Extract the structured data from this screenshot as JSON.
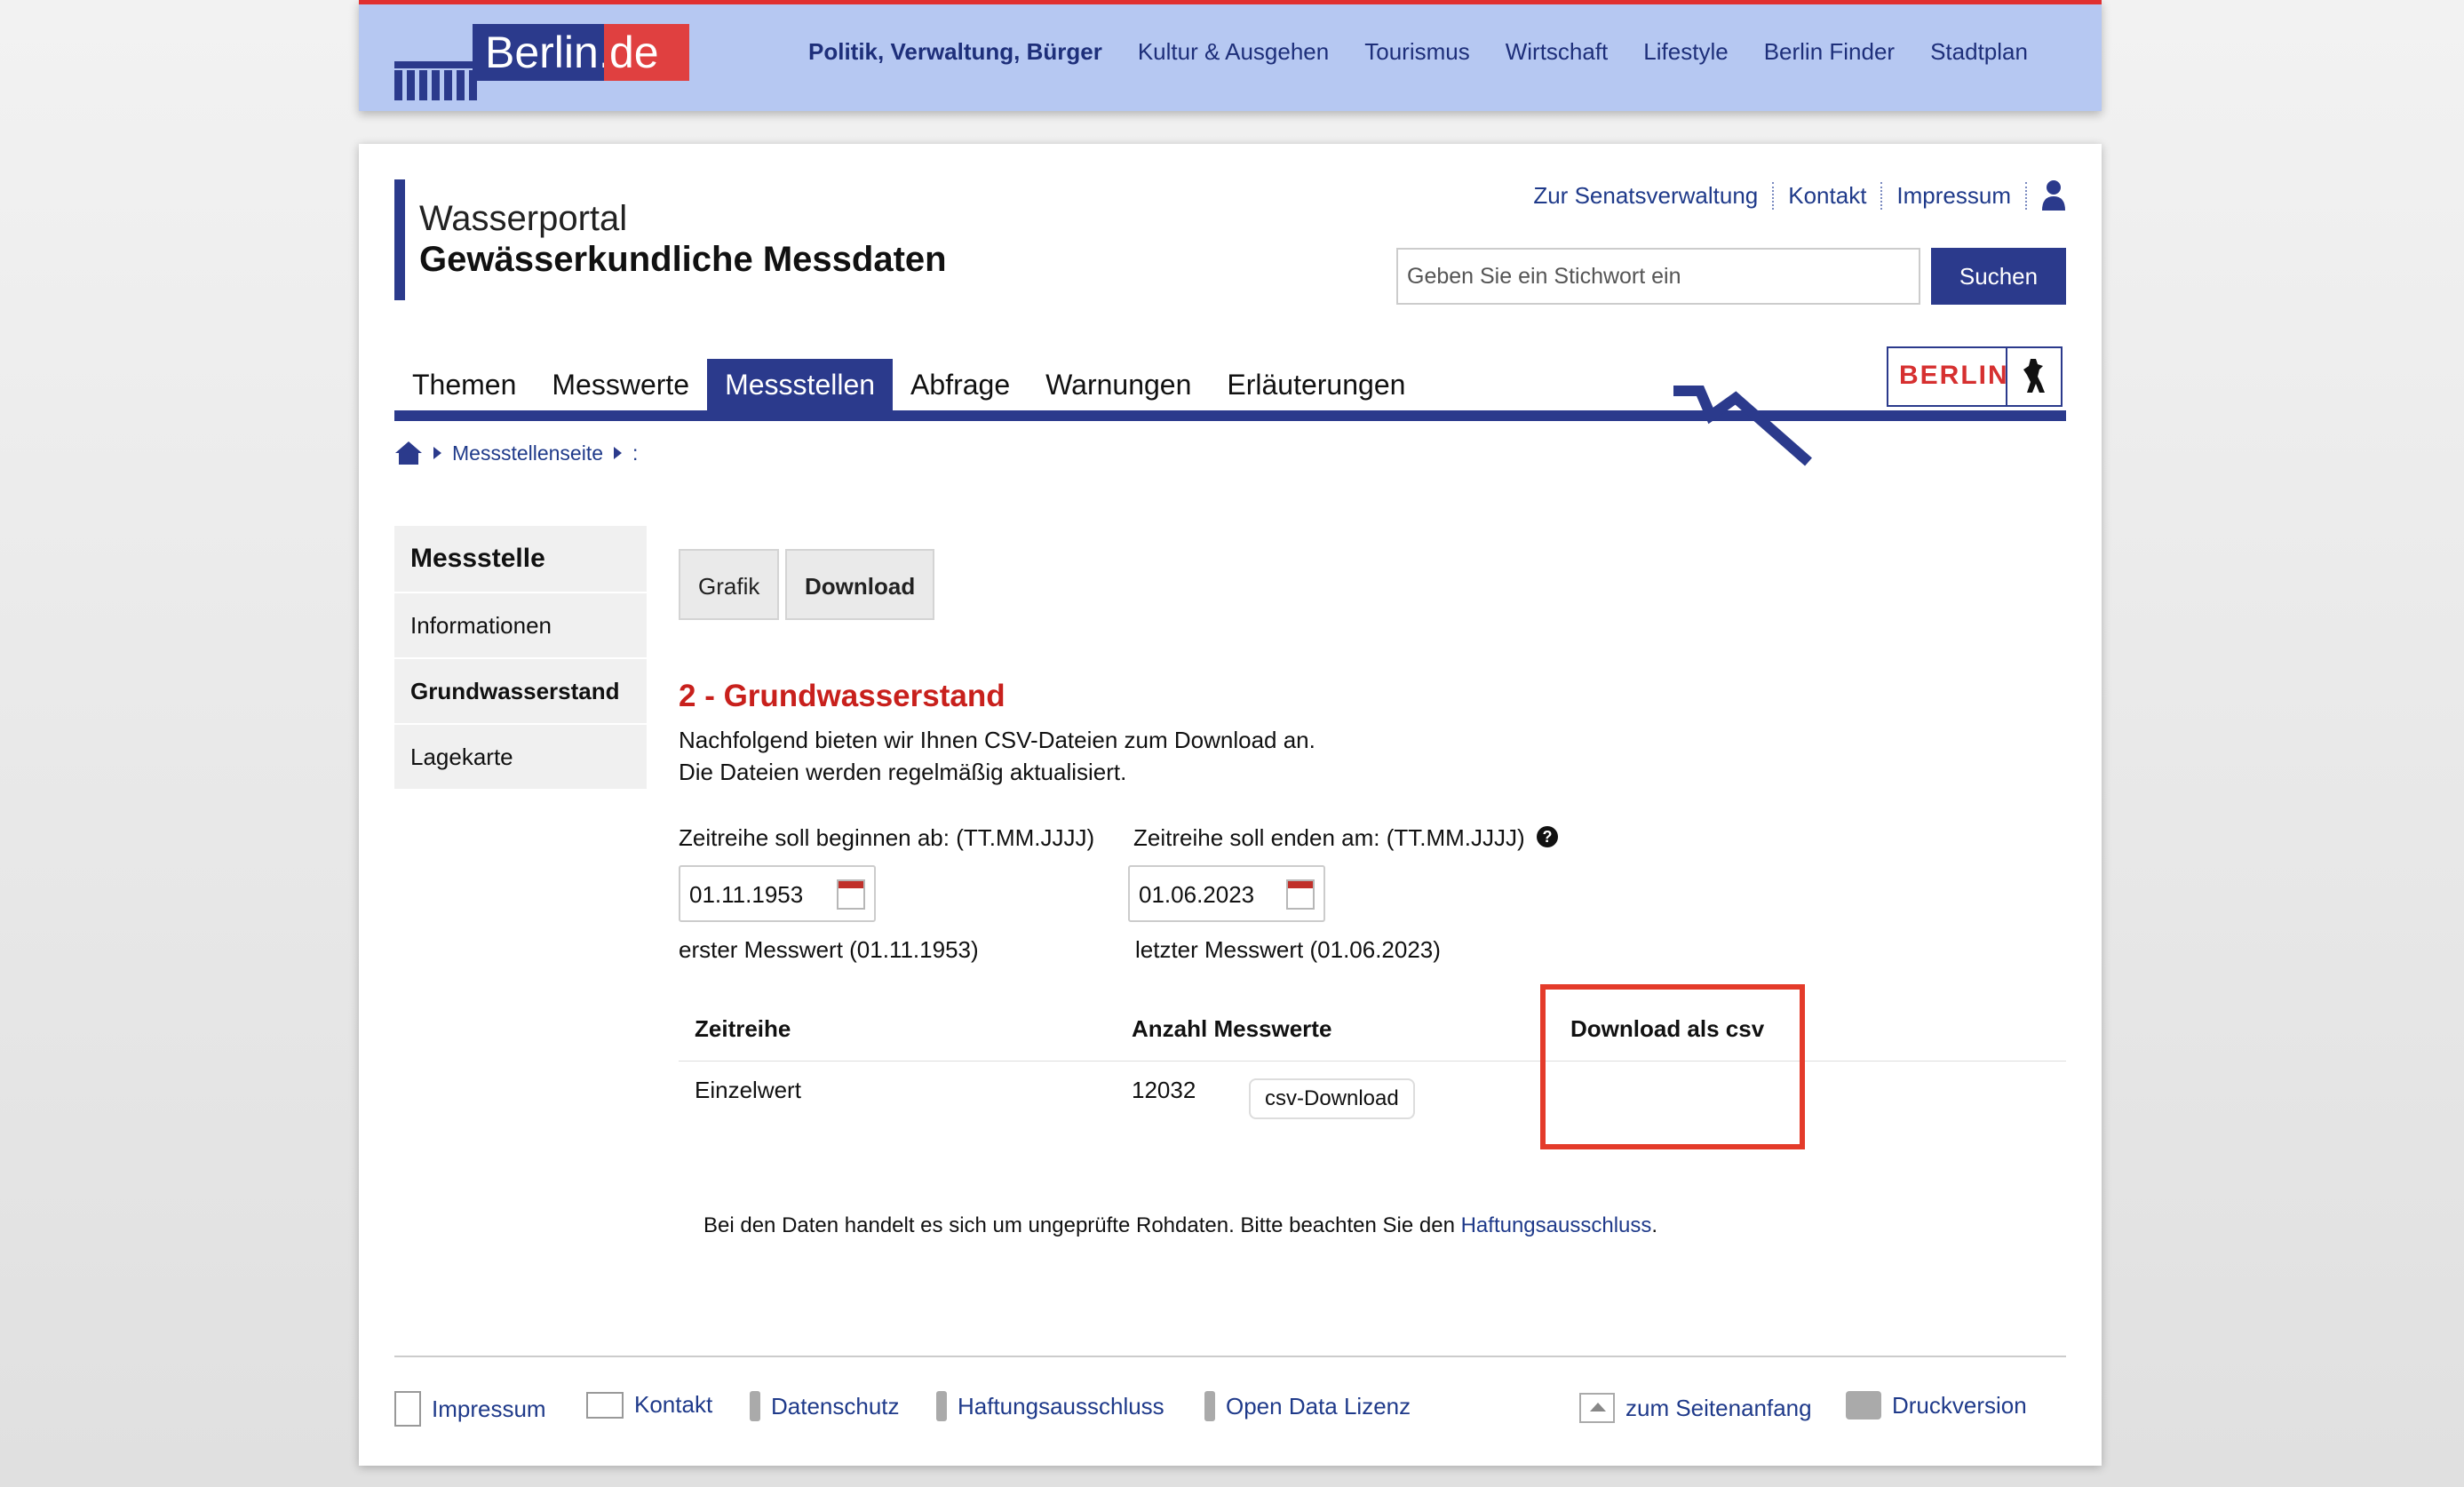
{
  "topbar": {
    "logo_text_main": "Berlin.",
    "logo_text_de": "de",
    "nav": [
      "Politik, Verwaltung, Bürger",
      "Kultur & Ausgehen",
      "Tourismus",
      "Wirtschaft",
      "Lifestyle",
      "Berlin Finder",
      "Stadtplan"
    ]
  },
  "header": {
    "title": "Wasserportal",
    "subtitle": "Gewässerkundliche Messdaten",
    "service_links": [
      "Zur Senatsverwaltung",
      "Kontakt",
      "Impressum"
    ],
    "search_placeholder": "Geben Sie ein Stichwort ein",
    "search_button": "Suchen",
    "berlin_badge": "BERLIN"
  },
  "mainnav": {
    "tabs": [
      "Themen",
      "Messwerte",
      "Messstellen",
      "Abfrage",
      "Warnungen",
      "Erläuterungen"
    ],
    "active": "Messstellen"
  },
  "breadcrumb": {
    "items": [
      "Messstellenseite",
      ":"
    ]
  },
  "sidemenu": {
    "heading": "Messstelle",
    "items": [
      "Informationen",
      "Grundwasserstand",
      "Lagekarte"
    ],
    "active": "Grundwasserstand"
  },
  "content": {
    "subtabs": [
      "Grafik",
      "Download"
    ],
    "title": "2 - Grundwasserstand",
    "intro_line1": "Nachfolgend bieten wir Ihnen CSV-Dateien zum Download an.",
    "intro_line2": "Die Dateien werden regelmäßig aktualisiert.",
    "start_label": "Zeitreihe soll beginnen ab: (TT.MM.JJJJ)",
    "start_value": "01.11.1953",
    "start_note": "erster Messwert (01.11.1953)",
    "end_label": "Zeitreihe soll enden am: (TT.MM.JJJJ)",
    "end_value": "01.06.2023",
    "end_note": "letzter Messwert (01.06.2023)",
    "help_glyph": "?",
    "table": {
      "headers": [
        "Zeitreihe",
        "Anzahl Messwerte",
        "Download als csv"
      ],
      "rows": [
        {
          "zeitreihe": "Einzelwert",
          "anzahl": "12032",
          "button": "csv-Download"
        }
      ]
    },
    "disclaimer_text": "Bei den Daten handelt es sich um ungeprüfte Rohdaten. Bitte beachten Sie den ",
    "disclaimer_link": "Haftungsausschluss",
    "disclaimer_end": "."
  },
  "footer": {
    "links": [
      "Impressum",
      "Kontakt",
      "Datenschutz",
      "Haftungsausschluss",
      "Open Data Lizenz"
    ],
    "top_link": "zum Seitenanfang",
    "print_link": "Druckversion"
  },
  "colors": {
    "primary": "#2b3a8c",
    "accent_red": "#c8201c",
    "highlight": "#e43b2a",
    "topbar": "#b6c8f2"
  }
}
